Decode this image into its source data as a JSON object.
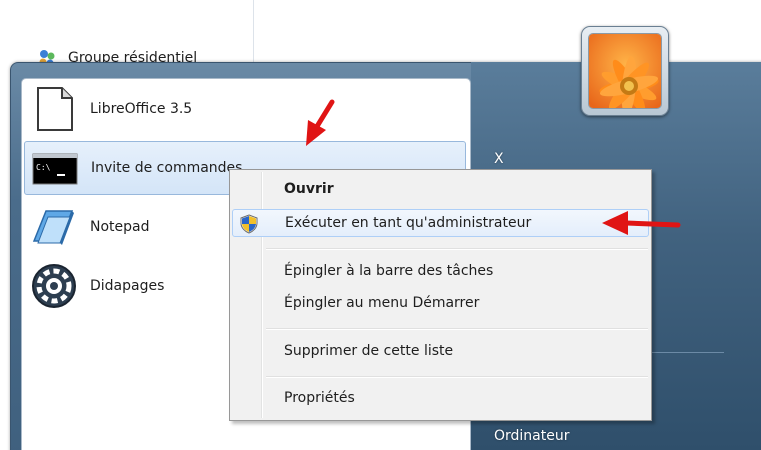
{
  "explorer": {
    "nav_item_label": "Groupe résidentiel"
  },
  "start_menu": {
    "programs": [
      {
        "label": "LibreOffice 3.5",
        "icon": "libreoffice-document-icon"
      },
      {
        "label": "Invite de commandes",
        "icon": "command-prompt-icon",
        "hovered": true
      },
      {
        "label": "Notepad",
        "icon": "notepad-icon"
      },
      {
        "label": "Didapages",
        "icon": "didapages-icon"
      }
    ],
    "right_pane": {
      "user_name": "X",
      "computer": "Ordinateur"
    }
  },
  "context_menu": {
    "items": [
      {
        "label": "Ouvrir",
        "bold": true
      },
      {
        "label": "Exécuter en tant qu'administrateur",
        "icon": "uac-shield-icon",
        "highlighted": true
      },
      {
        "label": "Épingler à la barre des tâches"
      },
      {
        "label": "Épingler au menu Démarrer"
      },
      {
        "label": "Supprimer de cette liste"
      },
      {
        "label": "Propriétés"
      }
    ]
  },
  "colors": {
    "annotation_arrow": "#e01414",
    "menu_highlight_border": "#aecff7",
    "start_menu_right_pane": "#41627f"
  }
}
